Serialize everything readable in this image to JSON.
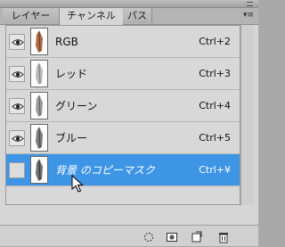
{
  "tabs": [
    {
      "label": "レイヤー",
      "active": false
    },
    {
      "label": "チャンネル",
      "active": true
    },
    {
      "label": "パス",
      "active": false
    }
  ],
  "panel_menu_icon": "panel-menu-icon",
  "channels": [
    {
      "name": "RGB",
      "shortcut": "Ctrl+2",
      "visible": true,
      "selected": false,
      "thumb_color": "#b06a44"
    },
    {
      "name": "レッド",
      "shortcut": "Ctrl+3",
      "visible": true,
      "selected": false,
      "thumb_color": "#8a8a8a"
    },
    {
      "name": "グリーン",
      "shortcut": "Ctrl+4",
      "visible": true,
      "selected": false,
      "thumb_color": "#707070"
    },
    {
      "name": "ブルー",
      "shortcut": "Ctrl+5",
      "visible": true,
      "selected": false,
      "thumb_color": "#5a5a5a"
    },
    {
      "name": "背景 のコピーマスク",
      "shortcut": "Ctrl+¥",
      "visible": false,
      "selected": true,
      "thumb_color": "#555555"
    }
  ],
  "footer_icons": [
    "load-selection-icon",
    "save-selection-icon",
    "new-channel-icon",
    "delete-channel-icon"
  ],
  "colors": {
    "selected_row": "#3e95e5",
    "panel_bg": "#d6d6d6"
  }
}
